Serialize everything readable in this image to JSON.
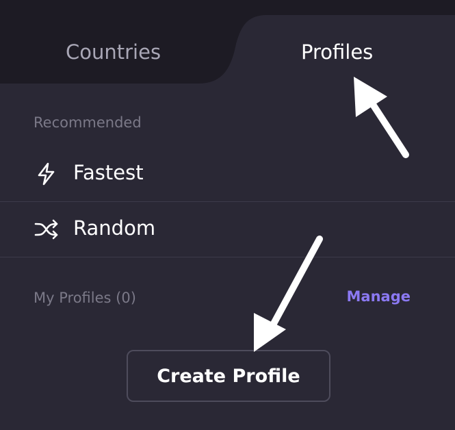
{
  "colors": {
    "panel_bg": "#2a2835",
    "inactive_tab_bg": "#1d1b24",
    "accent": "#8b79f2",
    "muted_text": "#7b7988",
    "divider": "#3d3b4a"
  },
  "tabs": [
    {
      "label": "Countries",
      "active": false
    },
    {
      "label": "Profiles",
      "active": true
    }
  ],
  "recommended": {
    "heading": "Recommended",
    "items": [
      {
        "label": "Fastest",
        "icon": "lightning-bolt-icon"
      },
      {
        "label": "Random",
        "icon": "shuffle-icon"
      }
    ]
  },
  "my_profiles": {
    "heading": "My Profiles (0)",
    "manage_label": "Manage"
  },
  "create_button_label": "Create Profile"
}
